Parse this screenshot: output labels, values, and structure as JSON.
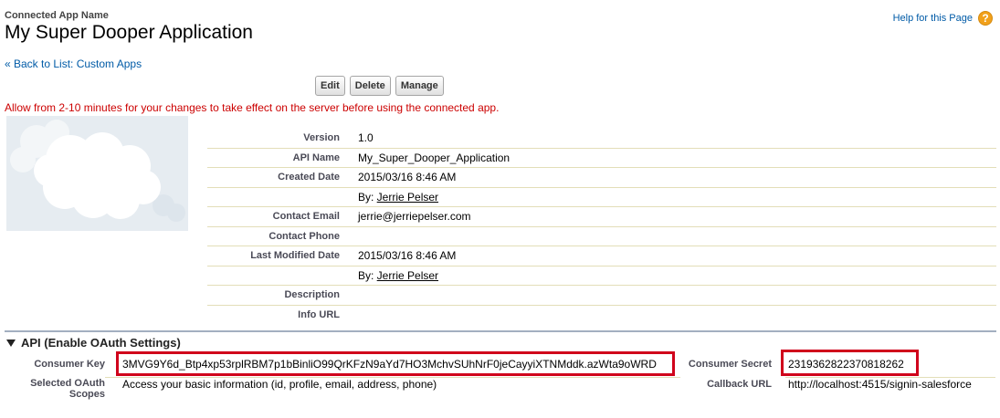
{
  "header": {
    "subtitle": "Connected App Name",
    "title": "My Super Dooper Application",
    "help_link": "Help for this Page",
    "help_icon_glyph": "?"
  },
  "nav": {
    "back_link": "« Back to List: Custom Apps"
  },
  "toolbar": {
    "edit_label": "Edit",
    "delete_label": "Delete",
    "manage_label": "Manage"
  },
  "warning": "Allow from 2-10 minutes for your changes to take effect on the server before using the connected app.",
  "logo": {
    "icon": "salesforce-cloud-placeholder-icon"
  },
  "details": {
    "version": {
      "label": "Version",
      "value": "1.0"
    },
    "api_name": {
      "label": "API Name",
      "value": "My_Super_Dooper_Application"
    },
    "created_date": {
      "label": "Created Date",
      "value": "2015/03/16 8:46 AM"
    },
    "created_by": {
      "prefix": "By: ",
      "name": "Jerrie Pelser"
    },
    "contact_email": {
      "label": "Contact Email",
      "value": "jerrie@jerriepelser.com"
    },
    "contact_phone": {
      "label": "Contact Phone",
      "value": ""
    },
    "last_modified_date": {
      "label": "Last Modified Date",
      "value": "2015/03/16 8:46 AM"
    },
    "modified_by": {
      "prefix": "By: ",
      "name": "Jerrie Pelser"
    },
    "description": {
      "label": "Description",
      "value": ""
    },
    "info_url": {
      "label": "Info URL",
      "value": ""
    }
  },
  "api_section": {
    "title": "API (Enable OAuth Settings)",
    "consumer_key": {
      "label": "Consumer Key",
      "value": "3MVG9Y6d_Btp4xp53rplRBM7p1bBinliO99QrKFzN9aYd7HO3MchvSUhNrF0jeCayyiXTNMddk.azWta9oWRD"
    },
    "consumer_secret": {
      "label": "Consumer Secret",
      "value": "2319362822370818262"
    },
    "selected_scopes": {
      "label_line1": "Selected OAuth",
      "label_line2": "Scopes",
      "value": "Access your basic information (id, profile, email, address, phone)"
    },
    "callback_url": {
      "label": "Callback URL",
      "value": "http://localhost:4515/signin-salesforce"
    }
  },
  "colors": {
    "link": "#015ba7",
    "warning": "#cc0000",
    "highlight_box": "#d0021b",
    "section_rule": "#a3afc0",
    "help_icon": "#f2a11b"
  }
}
